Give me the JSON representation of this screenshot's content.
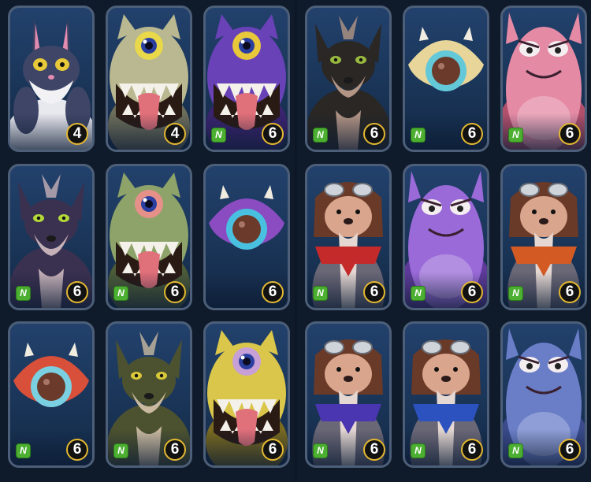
{
  "colors": {
    "card_bg": "#1a3558",
    "card_border": "#4d5f78",
    "level_ring": "#e3b832",
    "new_tag": "#4caf32"
  },
  "cards": [
    {
      "creature": "grey-rabbit",
      "level": "4",
      "new": false
    },
    {
      "creature": "cream-cyclops-yellow-eye",
      "level": "4",
      "new": false
    },
    {
      "creature": "purple-cyclops-yellow-eye",
      "level": "6",
      "new": true,
      "new_label": "N"
    },
    {
      "creature": "black-dog",
      "level": "6",
      "new": true,
      "new_label": "N"
    },
    {
      "creature": "cream-eyeball",
      "level": "6",
      "new": true,
      "new_label": "N"
    },
    {
      "creature": "pink-blob",
      "level": "6",
      "new": true,
      "new_label": "N"
    },
    {
      "creature": "dark-purple-dog",
      "level": "6",
      "new": true,
      "new_label": "N"
    },
    {
      "creature": "green-cyclops-purple-eye",
      "level": "6",
      "new": true,
      "new_label": "N"
    },
    {
      "creature": "purple-eyeball",
      "level": "6",
      "new": false
    },
    {
      "creature": "seal-red-scarf",
      "level": "6",
      "new": true,
      "new_label": "N"
    },
    {
      "creature": "purple-blob",
      "level": "6",
      "new": true,
      "new_label": "N"
    },
    {
      "creature": "seal-orange-scarf",
      "level": "6",
      "new": true,
      "new_label": "N"
    },
    {
      "creature": "red-eyeball",
      "level": "6",
      "new": true,
      "new_label": "N"
    },
    {
      "creature": "olive-dog",
      "level": "6",
      "new": true,
      "new_label": "N"
    },
    {
      "creature": "yellow-cyclops-purple-eye",
      "level": "6",
      "new": false
    },
    {
      "creature": "seal-purple-scarf",
      "level": "6",
      "new": true,
      "new_label": "N"
    },
    {
      "creature": "seal-blue-scarf",
      "level": "6",
      "new": true,
      "new_label": "N"
    },
    {
      "creature": "blue-blob",
      "level": "6",
      "new": true,
      "new_label": "N"
    }
  ]
}
